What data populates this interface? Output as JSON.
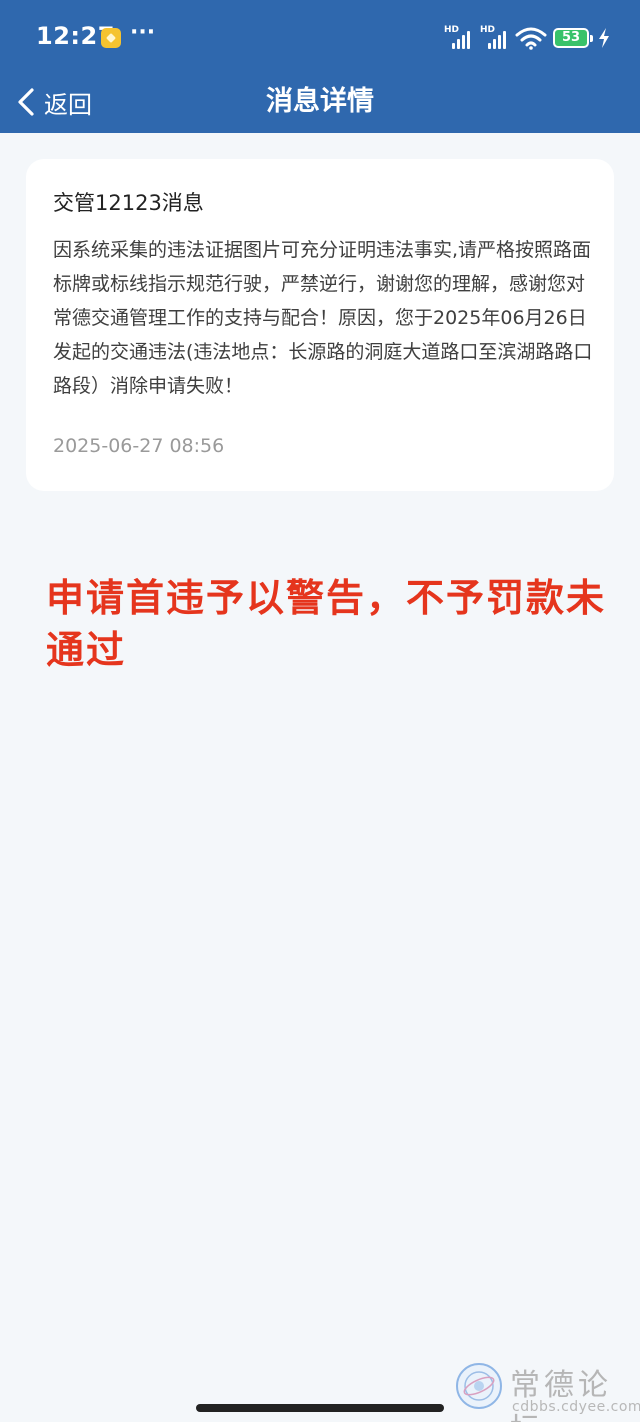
{
  "status_bar": {
    "time": "12:27",
    "more": "···",
    "network_1": "HD",
    "network_2": "HD",
    "battery": "53"
  },
  "nav": {
    "back_label": "返回",
    "title": "消息详情"
  },
  "message": {
    "title": "交管12123消息",
    "body": "因系统采集的违法证据图片可充分证明违法事实,请严格按照路面标牌或标线指示规范行驶，严禁逆行，谢谢您的理解，感谢您对常德交通管理工作的支持与配合！原因，您于2025年06月26日发起的交通违法(违法地点：长源路的洞庭大道路口至滨湖路路口路段）消除申请失败！",
    "time": "2025-06-27 08:56"
  },
  "annotation": {
    "text": "申请首违予以警告，不予罚款未通过",
    "color": "#e5351d"
  },
  "watermark": {
    "title": "常德论坛",
    "url": "cdbbs.cdyee.com"
  },
  "colors": {
    "header": "#2f68ae",
    "background": "#f4f7fa",
    "battery": "#39c26a"
  }
}
